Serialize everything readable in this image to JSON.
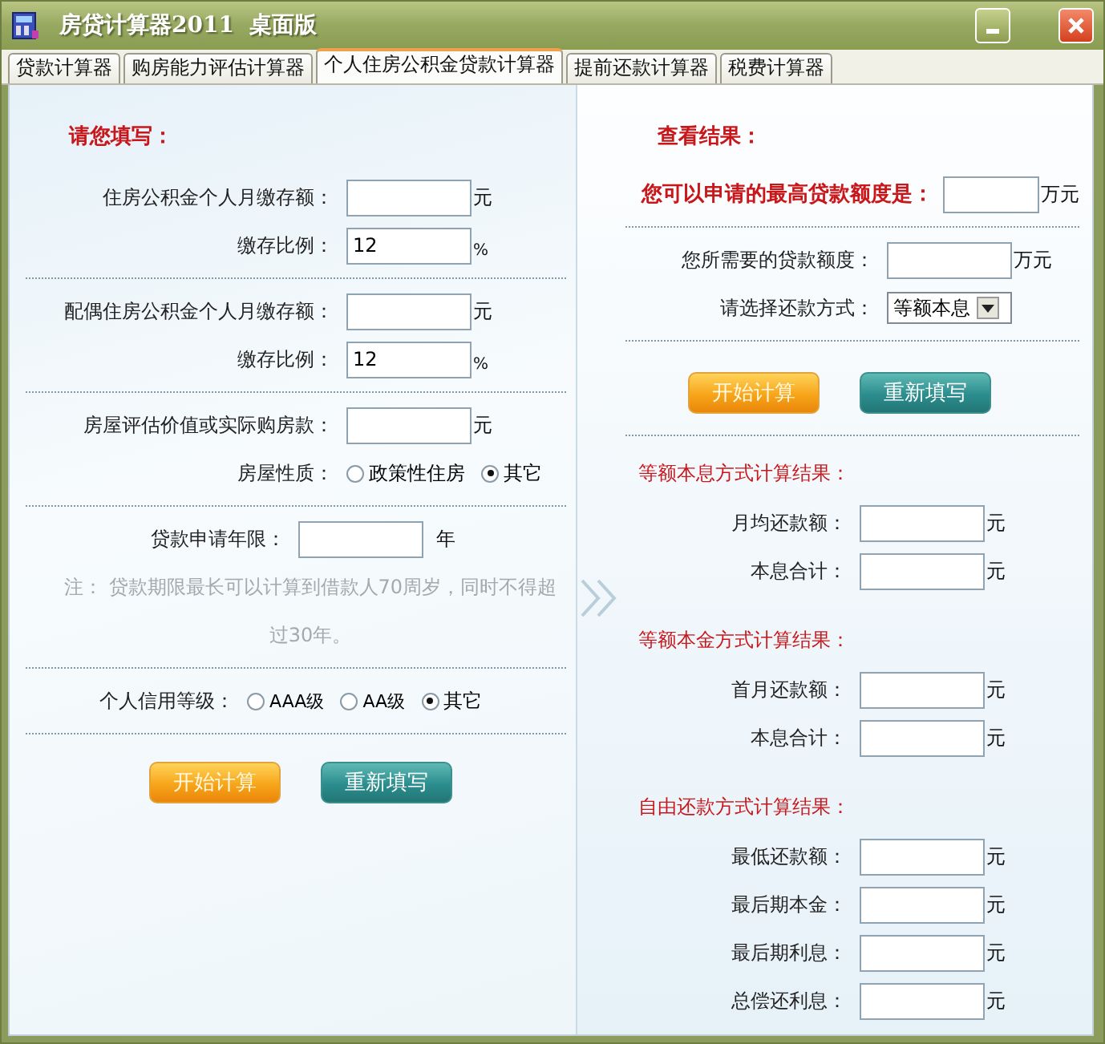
{
  "window": {
    "title": "房贷计算器2011  桌面版"
  },
  "tabs": [
    {
      "label": "贷款计算器",
      "selected": false
    },
    {
      "label": "购房能力评估计算器",
      "selected": false
    },
    {
      "label": "个人住房公积金贷款计算器",
      "selected": true
    },
    {
      "label": "提前还款计算器",
      "selected": false
    },
    {
      "label": "税费计算器",
      "selected": false
    }
  ],
  "left": {
    "heading": "请您填写：",
    "sections": [
      {
        "rows": [
          {
            "kind": "field",
            "label": "住房公积金个人月缴存额：",
            "unit": "元"
          },
          {
            "kind": "field",
            "label": "缴存比例：",
            "value": "12",
            "unit": "%"
          }
        ]
      },
      {
        "rows": [
          {
            "kind": "field",
            "label": "配偶住房公积金个人月缴存额：",
            "unit": "元"
          },
          {
            "kind": "field",
            "label": "缴存比例：",
            "value": "12",
            "unit": "%"
          }
        ]
      },
      {
        "rows": [
          {
            "kind": "field",
            "label": "房屋评估价值或实际购房款：",
            "unit": "元"
          },
          {
            "kind": "radio",
            "label": "房屋性质：",
            "options": [
              {
                "label": "政策性住房",
                "selected": false
              },
              {
                "label": "其它",
                "selected": true
              }
            ]
          }
        ]
      },
      {
        "rows": [
          {
            "kind": "field",
            "label": "贷款申请年限：",
            "unit": "年"
          },
          {
            "kind": "note",
            "text": "注： 贷款期限最长可以计算到借款人70周岁，同时不得超过30年。"
          }
        ]
      },
      {
        "rows": [
          {
            "kind": "radio",
            "label": "个人信用等级：",
            "options": [
              {
                "label": "AAA级",
                "selected": false
              },
              {
                "label": "AA级",
                "selected": false
              },
              {
                "label": "其它",
                "selected": true
              }
            ]
          }
        ]
      }
    ],
    "buttons": [
      {
        "kind": "start",
        "label": "开始计算"
      },
      {
        "kind": "reset",
        "label": "重新填写"
      }
    ]
  },
  "right": {
    "heading": "查看结果：",
    "sections": [
      {
        "rows": [
          {
            "kind": "highlight",
            "label": "您可以申请的最高贷款额度是：",
            "unit": "万元"
          }
        ]
      },
      {
        "rows": [
          {
            "kind": "field",
            "label": "您所需要的贷款额度：",
            "unit": "万元"
          },
          {
            "kind": "select",
            "label": "请选择还款方式：",
            "value": "等额本息"
          }
        ]
      }
    ],
    "buttons": [
      {
        "kind": "start",
        "label": "开始计算"
      },
      {
        "kind": "reset",
        "label": "重新填写"
      }
    ],
    "results": [
      {
        "title": "等额本息方式计算结果：",
        "rows": [
          {
            "label": "月均还款额：",
            "unit": "元"
          },
          {
            "label": "本息合计：",
            "unit": "元"
          }
        ]
      },
      {
        "title": "等额本金方式计算结果：",
        "rows": [
          {
            "label": "首月还款额：",
            "unit": "元"
          },
          {
            "label": "本息合计：",
            "unit": "元"
          }
        ]
      },
      {
        "title": "自由还款方式计算结果：",
        "rows": [
          {
            "label": "最低还款额：",
            "unit": "元"
          },
          {
            "label": "最后期本金：",
            "unit": "元"
          },
          {
            "label": "最后期利息：",
            "unit": "元"
          },
          {
            "label": "总偿还利息：",
            "unit": "元"
          }
        ]
      }
    ]
  }
}
